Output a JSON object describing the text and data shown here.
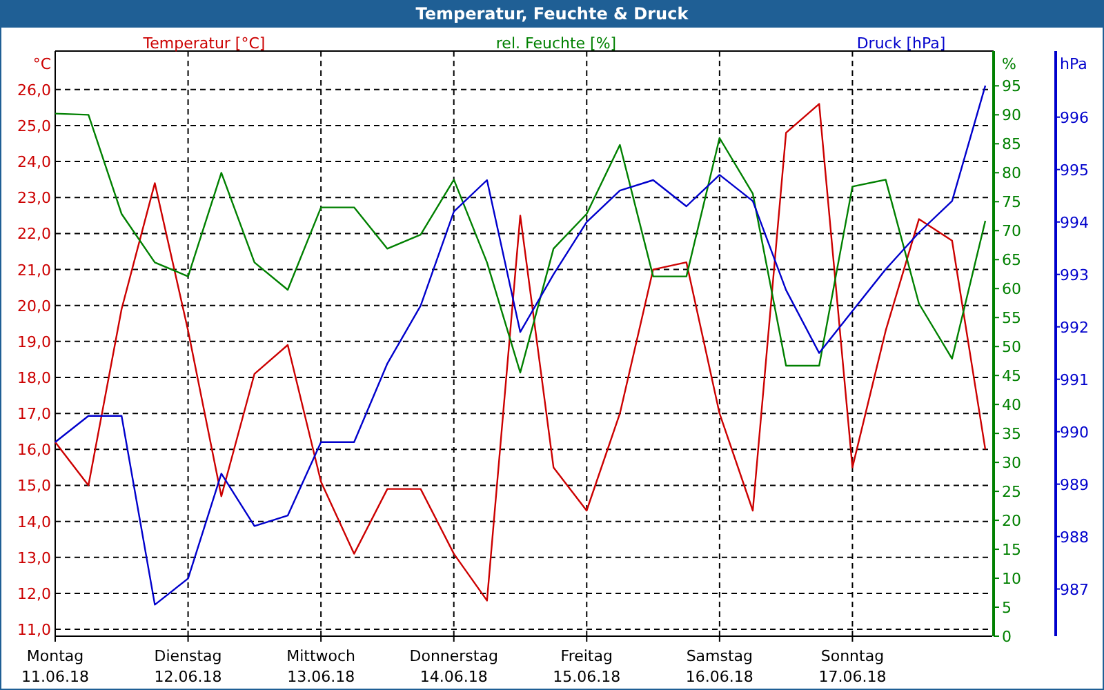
{
  "window": {
    "title": "Temperatur, Feuchte & Druck"
  },
  "chart": {
    "chart_data": {
      "type": "line",
      "grid": true,
      "categories": [
        "Montag\n11.06.18",
        null,
        null,
        null,
        "Dienstag\n12.06.18",
        null,
        null,
        null,
        "Mittwoch\n13.06.18",
        null,
        null,
        null,
        "Donnerstag\n14.06.18",
        null,
        null,
        null,
        "Freitag\n15.06.18",
        null,
        null,
        null,
        "Samstag\n16.06.18",
        null,
        null,
        null,
        "Sonntag\n17.06.18",
        null,
        null,
        null,
        null
      ],
      "ylabel": "°C",
      "ylim": [
        10.81,
        27.07
      ],
      "yticks": [
        {
          "value": 11,
          "label": "11,0"
        },
        {
          "value": 12,
          "label": "12,0"
        },
        {
          "value": 13,
          "label": "13,0"
        },
        {
          "value": 14,
          "label": "14,0"
        },
        {
          "value": 15,
          "label": "15,0"
        },
        {
          "value": 16,
          "label": "16,0"
        },
        {
          "value": 17,
          "label": "17,0"
        },
        {
          "value": 18,
          "label": "18,0"
        },
        {
          "value": 19,
          "label": "19,0"
        },
        {
          "value": 20,
          "label": "20,0"
        },
        {
          "value": 21,
          "label": "21,0"
        },
        {
          "value": 22,
          "label": "22,0"
        },
        {
          "value": 23,
          "label": "23,0"
        },
        {
          "value": 24,
          "label": "24,0"
        },
        {
          "value": 25,
          "label": "25,0"
        },
        {
          "value": 26,
          "label": "26,0"
        }
      ],
      "y2label": "%",
      "y2lim": [
        0,
        101
      ],
      "y2ticks": [
        0,
        5,
        10,
        15,
        20,
        25,
        30,
        35,
        40,
        45,
        50,
        55,
        60,
        65,
        70,
        75,
        80,
        85,
        90,
        95
      ],
      "y3label": "hPa",
      "y3lim": [
        986.1,
        997.26
      ],
      "y3ticks": [
        987,
        988,
        989,
        990,
        991,
        992,
        993,
        994,
        995,
        996
      ],
      "series": [
        {
          "name": "Temperatur [°C]",
          "color": "#cc0000",
          "values": [
            16.2,
            15.0,
            19.9,
            23.4,
            19.3,
            14.7,
            18.1,
            18.9,
            15.1,
            13.1,
            14.9,
            14.9,
            13.1,
            11.8,
            22.5,
            15.5,
            14.3,
            17.0,
            21.0,
            21.2,
            17.0,
            14.3,
            24.8,
            25.6,
            15.5,
            19.3,
            22.4,
            21.8,
            16.0
          ]
        },
        {
          "name": "rel. Feuchte [%]",
          "axis": "y2",
          "color": "#008000",
          "values": [
            90.2,
            90.0,
            72.9,
            64.5,
            62.1,
            80.0,
            64.5,
            59.8,
            74.0,
            74.0,
            66.9,
            69.3,
            78.8,
            64.5,
            45.5,
            66.9,
            72.9,
            84.8,
            62.1,
            62.1,
            86.0,
            76.4,
            46.7,
            46.7,
            77.6,
            78.8,
            57.4,
            47.9,
            71.7
          ]
        },
        {
          "name": "Druck [hPa]",
          "axis": "y3",
          "color": "#0000cc",
          "values": [
            989.8,
            990.3,
            990.3,
            986.7,
            987.2,
            989.2,
            988.2,
            988.4,
            989.8,
            989.8,
            991.3,
            992.4,
            994.2,
            994.8,
            991.9,
            993.0,
            994.0,
            994.6,
            994.8,
            994.3,
            994.9,
            994.4,
            992.7,
            991.5,
            992.3,
            993.1,
            993.8,
            994.4,
            996.6
          ]
        }
      ]
    }
  }
}
